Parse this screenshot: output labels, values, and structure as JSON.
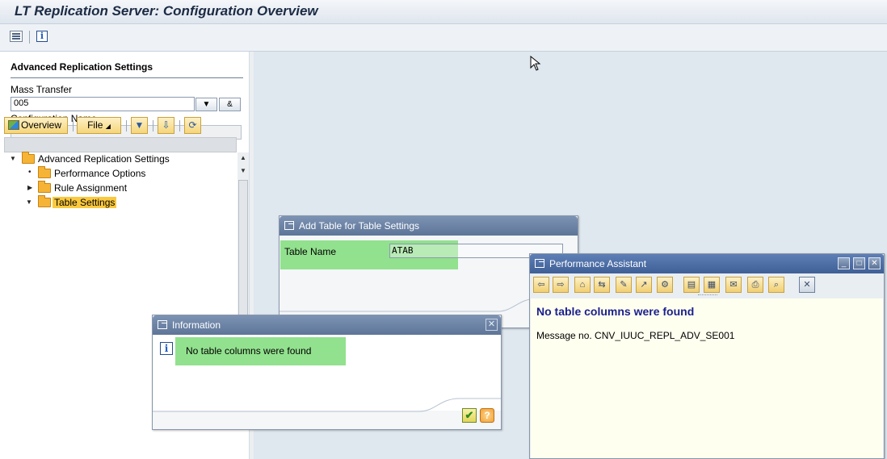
{
  "window": {
    "title": "LT Replication Server: Configuration Overview"
  },
  "toolbar": {
    "icons": [
      "list-icon",
      "info-icon"
    ]
  },
  "left": {
    "section_title": "Advanced Replication Settings",
    "mass_transfer_label": "Mass Transfer",
    "mass_transfer_value": "005",
    "config_name_label": "Configuration Name",
    "config_name_value": "",
    "nav": {
      "overview": "Overview",
      "file": "File"
    },
    "tree": [
      {
        "label": "Advanced Replication Settings",
        "expanded": true
      },
      {
        "label": "Performance Options"
      },
      {
        "label": "Rule Assignment"
      },
      {
        "label": "Table Settings",
        "selected": true
      }
    ]
  },
  "add_table_dialog": {
    "title": "Add Table for Table Settings",
    "field_label": "Table Name",
    "field_value": "ATAB"
  },
  "info_dialog": {
    "title": "Information",
    "message": "No table columns were found",
    "ok_glyph": "✔",
    "help_glyph": "?"
  },
  "perf_assistant": {
    "title": "Performance Assistant",
    "heading": "No table columns were found",
    "message": "Message no. CNV_IUUC_REPL_ADV_SE001"
  },
  "colors": {
    "highlight": "#92e18e",
    "title_blue": "#1b2b44",
    "heading_blue": "#1a1f8c",
    "tree_selected": "#fbc93e"
  }
}
